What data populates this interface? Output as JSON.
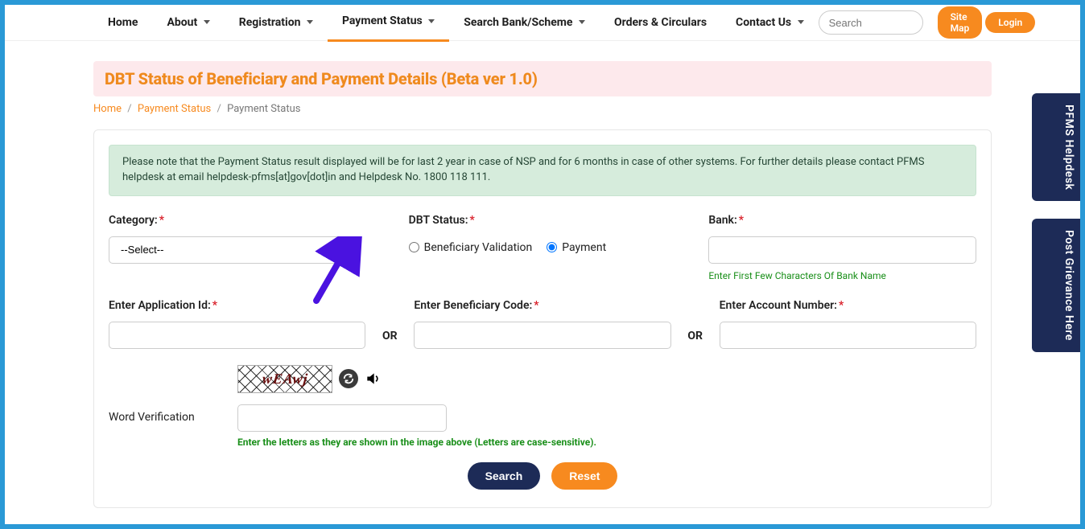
{
  "nav": {
    "items": [
      {
        "label": "Home",
        "dropdown": false,
        "active": false
      },
      {
        "label": "About",
        "dropdown": true,
        "active": false
      },
      {
        "label": "Registration",
        "dropdown": true,
        "active": false
      },
      {
        "label": "Payment Status",
        "dropdown": true,
        "active": true
      },
      {
        "label": "Search Bank/Scheme",
        "dropdown": true,
        "active": false
      },
      {
        "label": "Orders & Circulars",
        "dropdown": false,
        "active": false
      },
      {
        "label": "Contact Us",
        "dropdown": true,
        "active": false
      }
    ],
    "search_placeholder": "Search",
    "site_map": "Site Map",
    "login": "Login"
  },
  "title": "DBT Status of Beneficiary and Payment Details (Beta ver 1.0)",
  "breadcrumb": {
    "home": "Home",
    "mid": "Payment Status",
    "current": "Payment Status"
  },
  "note": "Please note that the Payment Status result displayed will be for last 2 year in case of NSP and for 6 months in case of other systems. For further details please contact PFMS helpdesk at email helpdesk-pfms[at]gov[dot]in and Helpdesk No. 1800 118 111.",
  "form": {
    "category_label": "Category:",
    "category_value": "--Select--",
    "dbt_label": "DBT Status:",
    "radio_validation": "Beneficiary Validation",
    "radio_payment": "Payment",
    "bank_label": "Bank:",
    "bank_hint": "Enter First Few Characters Of Bank Name",
    "app_id_label": "Enter Application Id:",
    "ben_code_label": "Enter Beneficiary Code:",
    "acct_label": "Enter Account Number:",
    "or": "OR",
    "captcha_text": "wEAwj",
    "wv_label": "Word Verification",
    "wv_hint": "Enter the letters as they are shown in the image above (Letters are case-sensitive).",
    "search_btn": "Search",
    "reset_btn": "Reset"
  },
  "side": {
    "helpdesk": "PFMS Helpdesk",
    "grievance": "Post Grievance Here"
  }
}
